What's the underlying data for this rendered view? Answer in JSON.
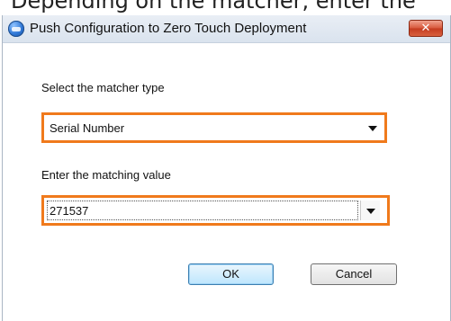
{
  "page_caption": "Depending on the matcher, enter the",
  "dialog": {
    "title": "Push Configuration to Zero Touch Deployment",
    "close_glyph": "✕"
  },
  "form": {
    "matcher_type_label": "Select the matcher type",
    "matcher_type_value": "Serial Number",
    "matching_value_label": "Enter the matching value",
    "matching_value": "271537"
  },
  "buttons": {
    "ok": "OK",
    "cancel": "Cancel"
  },
  "colors": {
    "highlight": "#f07a1c",
    "close_button": "#d7583b"
  }
}
